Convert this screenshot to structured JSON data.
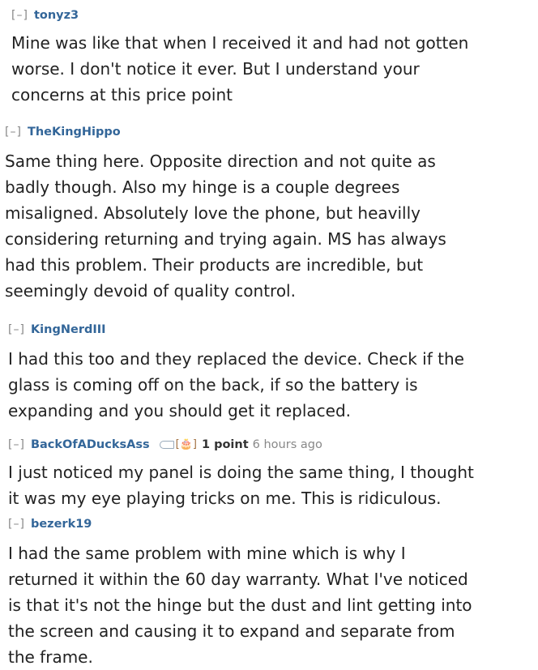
{
  "expand_label": "[–]",
  "comments": [
    {
      "author": "tonyz3",
      "body": [
        "Mine was like that when I received it and had not gotten",
        "worse. I don't notice it ever. But I understand your",
        "concerns at this price point"
      ]
    },
    {
      "author": "TheKingHippo",
      "body": [
        "Same thing here. Opposite direction and not quite as",
        "badly though. Also my hinge is a couple degrees",
        "misaligned. Absolutely love the phone, but heavilly",
        "considering returning and trying again. MS has always",
        "had this problem. Their products are incredible, but",
        "seemingly devoid of quality control."
      ]
    },
    {
      "author": "KingNerdIII",
      "body": [
        "I had this too and they replaced the device. Check if the",
        "glass is coming off on the back, if so the battery is",
        "expanding and you should get it replaced."
      ]
    },
    {
      "author": "BackOfADucksAss",
      "icons": [
        "tag-icon",
        "cake-icon"
      ],
      "score": "1 point",
      "time": "6 hours ago",
      "body": [
        "I just noticed my panel is doing the same thing, I thought",
        "it was my eye playing tricks on me. This is ridiculous."
      ]
    },
    {
      "author": "bezerk19",
      "body": [
        "I had the same problem with mine which is why I",
        "returned it within the 60 day warranty. What I've noticed",
        "is that it's not the hinge but the dust and lint getting into",
        "the screen and causing it to expand and separate from",
        "the frame."
      ]
    }
  ]
}
